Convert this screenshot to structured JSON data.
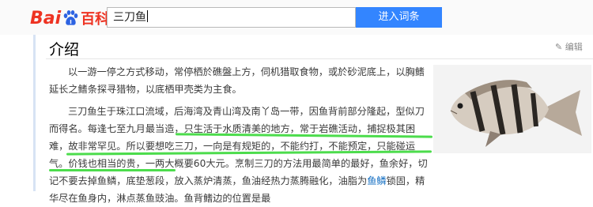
{
  "header": {
    "logo_bai": "Bai",
    "logo_du": "du",
    "logo_baike": "百科",
    "search_value": "三刀鱼",
    "search_button": "进入词条"
  },
  "section": {
    "title": "介绍",
    "edit_label": "编辑"
  },
  "content": {
    "paragraph1": "以一游一停之方式移动，常停栖於礁盤上方，伺机猎取食物，或於砂泥底上，以胸鳍延长之鳍条探寻猎物，以底栖甲壳类为主食。",
    "p2_a": "三刀鱼生于珠江口流域，后海湾及青山湾及南丫岛一带，因鱼背前部分隆起，型似刀而得名。每逢七至九月最当造，只生活于水质清美的地方，常于岩礁活动，捕捉极其困难，故非常罕见。所以要想吃三刀，一向是有规矩的，不能约打，不能预定，只能碰运气。价钱也相当的贵，一两大概要60大元。烹制三刀的方法用最简单的最好，鱼余好，切记不要去掉鱼鳞，底垫葱段，放入蒸炉清蒸，鱼油经热力蒸腾融化，油脂为",
    "p2_link": "鱼鳞",
    "p2_b": "锁固，精华尽在鱼身内，淋点蒸鱼豉油。鱼背鳍边的位置是最"
  },
  "colors": {
    "accent": "#3385ff",
    "brand": "#e32e2e",
    "highlight": "#38d838"
  }
}
